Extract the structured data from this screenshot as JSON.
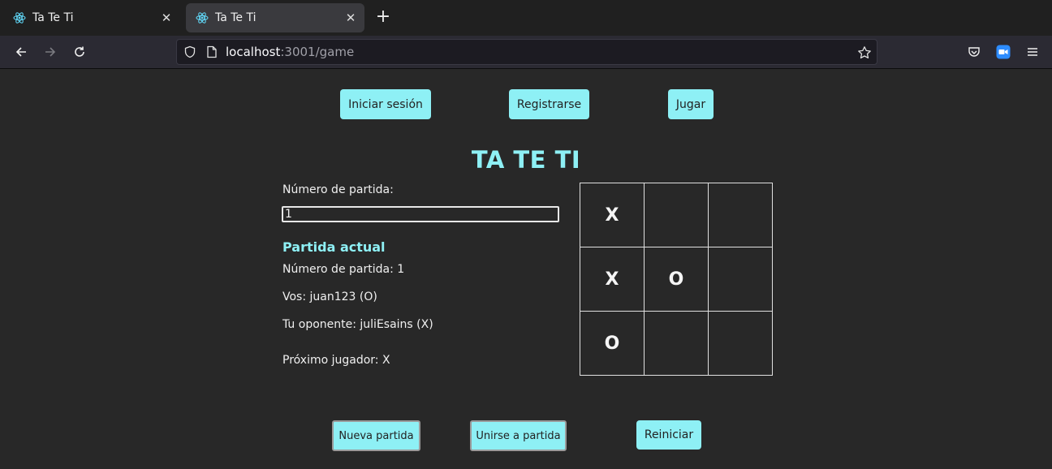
{
  "browser": {
    "tabs": [
      {
        "title": "Ta Te Ti",
        "active": false
      },
      {
        "title": "Ta Te Ti",
        "active": true
      }
    ],
    "url_host": "localhost",
    "url_path": ":3001/game"
  },
  "nav": {
    "login": "Iniciar sesión",
    "register": "Registrarse",
    "play": "Jugar"
  },
  "game": {
    "title": "TA TE TI",
    "match_number_label": "Número de partida:",
    "match_number_value": "1",
    "current_match_title": "Partida actual",
    "match_number_info": "Número de partida: 1",
    "you": "Vos: juan123 (O)",
    "opponent": "Tu oponente: juliEsains (X)",
    "next_player": "Próximo jugador: X",
    "board": [
      "X",
      "",
      "",
      "X",
      "O",
      "",
      "O",
      "",
      ""
    ]
  },
  "actions": {
    "new_match": "Nueva partida",
    "join_match": "Unirse a partida",
    "restart": "Reiniciar"
  },
  "colors": {
    "accent": "#8ef0f5",
    "background": "#282828"
  }
}
